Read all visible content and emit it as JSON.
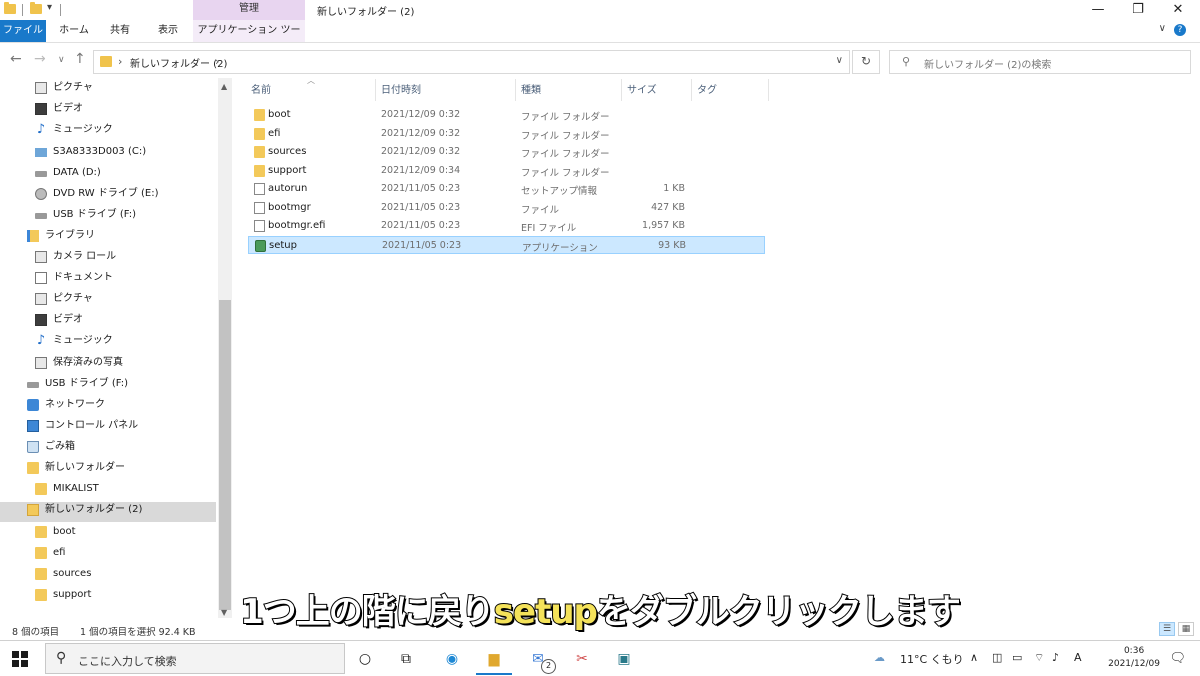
{
  "titlebar": {
    "context_tab": "管理",
    "window_title": "新しいフォルダー (2)",
    "minimize": "—",
    "maximize": "❐",
    "close": "✕"
  },
  "ribbon": {
    "tabs": [
      "ファイル",
      "ホーム",
      "共有",
      "表示",
      "アプリケーション ツール"
    ]
  },
  "address": {
    "path": "新しいフォルダー (2)",
    "search_placeholder": "新しいフォルダー (2)の検索"
  },
  "nav_pane": {
    "items": [
      {
        "label": "ピクチャ",
        "icon": "picture-icon"
      },
      {
        "label": "ビデオ",
        "icon": "video-icon"
      },
      {
        "label": "ミュージック",
        "icon": "music-icon"
      },
      {
        "label": "S3A8333D003 (C:)",
        "icon": "windows-drive-icon"
      },
      {
        "label": "DATA (D:)",
        "icon": "drive-icon"
      },
      {
        "label": "DVD RW ドライブ (E:)",
        "icon": "dvd-icon"
      },
      {
        "label": "USB ドライブ (F:)",
        "icon": "usb-drive-icon"
      },
      {
        "label": "ライブラリ",
        "icon": "library-icon"
      },
      {
        "label": "カメラ ロール",
        "icon": "camera-roll-icon"
      },
      {
        "label": "ドキュメント",
        "icon": "document-icon"
      },
      {
        "label": "ピクチャ",
        "icon": "picture-icon"
      },
      {
        "label": "ビデオ",
        "icon": "video-icon"
      },
      {
        "label": "ミュージック",
        "icon": "music-icon"
      },
      {
        "label": "保存済みの写真",
        "icon": "saved-pictures-icon"
      },
      {
        "label": "USB ドライブ (F:)",
        "icon": "usb-drive-icon"
      },
      {
        "label": "ネットワーク",
        "icon": "network-icon"
      },
      {
        "label": "コントロール パネル",
        "icon": "control-panel-icon"
      },
      {
        "label": "ごみ箱",
        "icon": "recycle-bin-icon"
      },
      {
        "label": "新しいフォルダー",
        "icon": "folder-icon"
      },
      {
        "label": "MIKALIST",
        "icon": "folder-icon"
      },
      {
        "label": "新しいフォルダー (2)",
        "icon": "folder-open-icon",
        "selected": true
      },
      {
        "label": "boot",
        "icon": "folder-icon"
      },
      {
        "label": "efi",
        "icon": "folder-icon"
      },
      {
        "label": "sources",
        "icon": "folder-icon"
      },
      {
        "label": "support",
        "icon": "folder-icon"
      }
    ]
  },
  "columns": [
    "名前",
    "日付時刻",
    "種類",
    "サイズ",
    "タグ"
  ],
  "files": [
    {
      "name": "boot",
      "date": "2021/12/09 0:32",
      "type": "ファイル フォルダー",
      "size": "",
      "icon": "folder-icon"
    },
    {
      "name": "efi",
      "date": "2021/12/09 0:32",
      "type": "ファイル フォルダー",
      "size": "",
      "icon": "folder-icon"
    },
    {
      "name": "sources",
      "date": "2021/12/09 0:32",
      "type": "ファイル フォルダー",
      "size": "",
      "icon": "folder-icon"
    },
    {
      "name": "support",
      "date": "2021/12/09 0:34",
      "type": "ファイル フォルダー",
      "size": "",
      "icon": "folder-icon"
    },
    {
      "name": "autorun",
      "date": "2021/11/05 0:23",
      "type": "セットアップ情報",
      "size": "1 KB",
      "icon": "setup-info-icon"
    },
    {
      "name": "bootmgr",
      "date": "2021/11/05 0:23",
      "type": "ファイル",
      "size": "427 KB",
      "icon": "file-icon"
    },
    {
      "name": "bootmgr.efi",
      "date": "2021/11/05 0:23",
      "type": "EFI ファイル",
      "size": "1,957 KB",
      "icon": "file-icon"
    },
    {
      "name": "setup",
      "date": "2021/11/05 0:23",
      "type": "アプリケーション",
      "size": "93 KB",
      "icon": "setup-app-icon",
      "selected": true
    }
  ],
  "status": {
    "item_count": "8 個の項目",
    "selection": "1 個の項目を選択  92.4 KB"
  },
  "subtitle": {
    "before": "1つ上の階に戻り",
    "highlight": "setup",
    "after": "をダブルクリックします"
  },
  "taskbar": {
    "search_placeholder": "ここに入力して検索",
    "mail_badge": "2",
    "weather": "11°C くもり",
    "ime": "A",
    "time": "0:36",
    "date": "2021/12/09"
  },
  "colors": {
    "file_tab": "#1979ca",
    "context_tab": "#e8d5f0",
    "selection": "#cce8ff",
    "subtitle_highlight": "#f4e25a"
  }
}
